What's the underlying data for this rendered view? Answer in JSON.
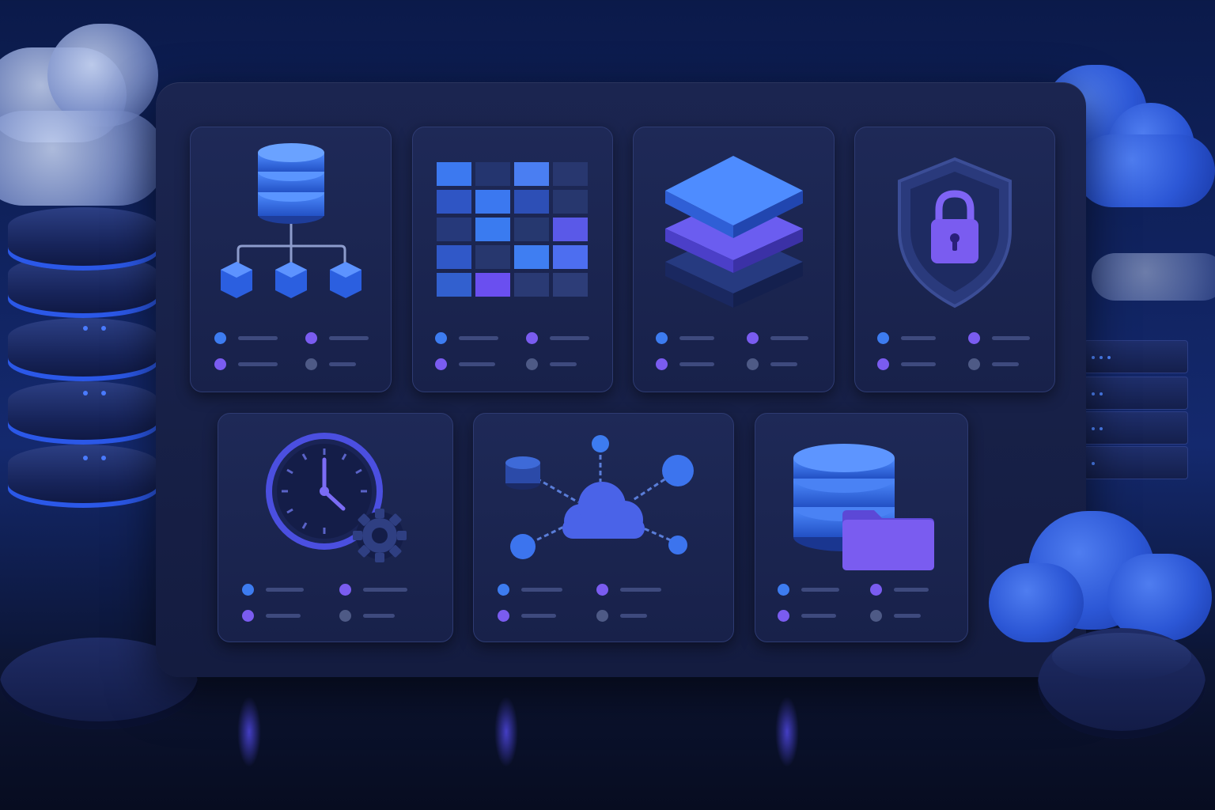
{
  "palette": {
    "accent_blue": "#3d7cf0",
    "accent_violet": "#7a5cf0",
    "muted_gray": "#4e5a86",
    "board": "#161e44",
    "card": "#1b2550"
  },
  "cards": [
    {
      "icon": "database-hierarchy-icon"
    },
    {
      "icon": "data-grid-icon"
    },
    {
      "icon": "layers-icon"
    },
    {
      "icon": "shield-lock-icon"
    },
    {
      "icon": "clock-gear-icon"
    },
    {
      "icon": "cloud-network-icon"
    },
    {
      "icon": "database-folder-icon"
    }
  ]
}
